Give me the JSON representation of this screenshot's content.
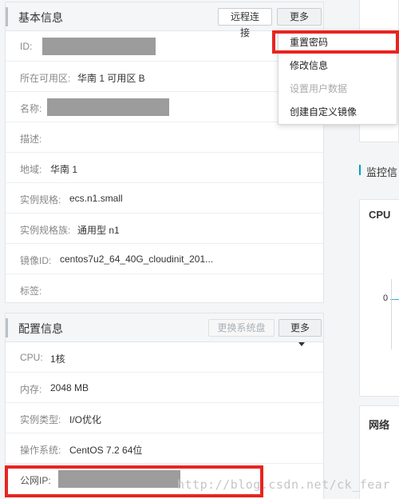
{
  "basic": {
    "title": "基本信息",
    "remote_btn": "远程连接",
    "more_btn": "更多",
    "rows": [
      {
        "label": "ID:",
        "value": ""
      },
      {
        "label": "所在可用区:",
        "value": "华南 1 可用区 B"
      },
      {
        "label": "名称:",
        "value": ""
      },
      {
        "label": "描述:",
        "value": ""
      },
      {
        "label": "地域:",
        "value": "华南 1"
      },
      {
        "label": "实例规格:",
        "value": "ecs.n1.small"
      },
      {
        "label": "实例规格族:",
        "value": "通用型 n1"
      },
      {
        "label": "镜像ID:",
        "value": "centos7u2_64_40G_cloudinit_201..."
      },
      {
        "label": "标签:",
        "value": ""
      }
    ]
  },
  "dropdown": {
    "items": [
      {
        "label": "重置密码",
        "disabled": false
      },
      {
        "label": "修改信息",
        "disabled": false
      },
      {
        "label": "设置用户数据",
        "disabled": true
      },
      {
        "label": "创建自定义镜像",
        "disabled": false
      }
    ]
  },
  "config": {
    "title": "配置信息",
    "change_disk_btn": "更换系统盘",
    "more_btn": "更多",
    "rows": [
      {
        "label": "CPU:",
        "value": "1核"
      },
      {
        "label": "内存:",
        "value": "2048 MB"
      },
      {
        "label": "实例类型:",
        "value": "I/O优化"
      },
      {
        "label": "操作系统:",
        "value": "CentOS 7.2 64位"
      },
      {
        "label": "公网IP:",
        "value": ""
      }
    ]
  },
  "right": {
    "monitor_title": "监控信",
    "cpu_title": "CPU",
    "cpu_axis_zero": "0",
    "net_title": "网络"
  },
  "watermark": "http://blog.csdn.net/ck_fear",
  "colors": {
    "highlight": "#e8241f",
    "accent": "#00a2ca"
  }
}
